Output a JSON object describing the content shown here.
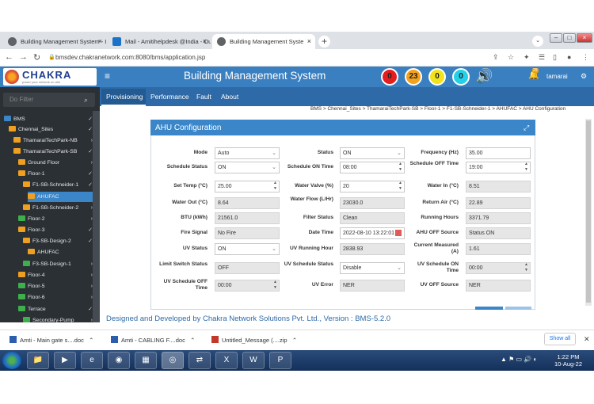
{
  "browser": {
    "tabs": [
      {
        "label": "Building Management System - I",
        "active": false
      },
      {
        "label": "Mail - Amitihelpdesk @India - Ou",
        "active": false
      },
      {
        "label": "Building Management Syste",
        "active": true
      }
    ],
    "url": "bmsdev.chakranetwork.com:8080/bms/application.jsp"
  },
  "header": {
    "logo_text": "CHAKRA",
    "logo_sub": "power your network on ahe",
    "title": "Building Management System",
    "alarm_counts": [
      {
        "value": "0",
        "color": "#e31e1e"
      },
      {
        "value": "23",
        "color": "#f5a21a"
      },
      {
        "value": "0",
        "color": "#f2e21b"
      },
      {
        "value": "0",
        "color": "#22d0e8"
      }
    ],
    "bell_count": "29",
    "user": "tamarai"
  },
  "sidebar": {
    "filter_placeholder": "Do Filter",
    "items": [
      {
        "label": "BMS",
        "indent": 0,
        "color": "#3a86c8",
        "chev": "✓"
      },
      {
        "label": "Chennai_Sites",
        "indent": 1,
        "color": "#f0a020",
        "chev": "✓"
      },
      {
        "label": "ThamaraiTechPark-NB",
        "indent": 2,
        "color": "#f0a020",
        "chev": "›"
      },
      {
        "label": "ThamaraiTechPark-SB",
        "indent": 2,
        "color": "#f0a020",
        "chev": "✓"
      },
      {
        "label": "Ground Floor",
        "indent": 3,
        "color": "#f0a020",
        "chev": "›"
      },
      {
        "label": "Floor-1",
        "indent": 3,
        "color": "#f0a020",
        "chev": "✓"
      },
      {
        "label": "F1-SB-Schneider-1",
        "indent": 4,
        "color": "#f0a020",
        "chev": "✓"
      },
      {
        "label": "AHUFAC",
        "indent": 5,
        "color": "#f0a020",
        "chev": "",
        "selected": true
      },
      {
        "label": "F1-SB-Schneider-2",
        "indent": 4,
        "color": "#f0a020",
        "chev": "›"
      },
      {
        "label": "Floor-2",
        "indent": 3,
        "color": "#3cb04a",
        "chev": "›"
      },
      {
        "label": "Floor-3",
        "indent": 3,
        "color": "#f0a020",
        "chev": "✓"
      },
      {
        "label": "F3-SB-Design-2",
        "indent": 4,
        "color": "#f0a020",
        "chev": "✓"
      },
      {
        "label": "AHUFAC",
        "indent": 5,
        "color": "#f0a020",
        "chev": ""
      },
      {
        "label": "F3-SB-Design-1",
        "indent": 4,
        "color": "#3cb04a",
        "chev": "›"
      },
      {
        "label": "Floor-4",
        "indent": 3,
        "color": "#f0a020",
        "chev": "›"
      },
      {
        "label": "Floor-5",
        "indent": 3,
        "color": "#3cb04a",
        "chev": "›"
      },
      {
        "label": "Floor-6",
        "indent": 3,
        "color": "#3cb04a",
        "chev": "›"
      },
      {
        "label": "Terrace",
        "indent": 3,
        "color": "#3cb04a",
        "chev": "✓"
      },
      {
        "label": "Secondary-Pump",
        "indent": 4,
        "color": "#3cb04a",
        "chev": "›"
      }
    ]
  },
  "menu": [
    "Provisioning",
    "Performance",
    "Fault",
    "About"
  ],
  "breadcrumb": "BMS  >  Chennai_Sites  >  ThamaraiTechPark-SB  >  Floor-1  >  F1-SB-Schneider-1  >  AHUFAC  >  AHU Configuration",
  "panel": {
    "title": "AHU Configuration",
    "fields": [
      {
        "label": "Mode",
        "value": "Auto",
        "type": "select"
      },
      {
        "label": "Status",
        "value": "ON",
        "type": "select"
      },
      {
        "label": "Frequency (Hz)",
        "value": "35.00",
        "type": "text"
      },
      {
        "label": "Schedule Status",
        "value": "ON",
        "type": "select"
      },
      {
        "label": "Schedule ON Time",
        "value": "08:00",
        "type": "spin"
      },
      {
        "label": "Schedule OFF Time",
        "value": "19:00",
        "type": "spin"
      },
      {
        "label": "Set Temp (°C)",
        "value": "25.00",
        "type": "spin"
      },
      {
        "label": "Water Valve (%)",
        "value": "20",
        "type": "spin"
      },
      {
        "label": "Water In (°C)",
        "value": "8.51",
        "type": "ro"
      },
      {
        "label": "Water Out (°C)",
        "value": "8.64",
        "type": "ro"
      },
      {
        "label": "Water Flow (L/Hr)",
        "value": "23030.0",
        "type": "ro"
      },
      {
        "label": "Return Air (°C)",
        "value": "22.89",
        "type": "ro"
      },
      {
        "label": "BTU (kWh)",
        "value": "21561.0",
        "type": "ro"
      },
      {
        "label": "Filter Status",
        "value": "Clean",
        "type": "ro"
      },
      {
        "label": "Running Hours",
        "value": "3371.79",
        "type": "ro"
      },
      {
        "label": "Fire Signal",
        "value": "No Fire",
        "type": "ro"
      },
      {
        "label": "Date Time",
        "value": "2022-08-10 13:22:01",
        "type": "date"
      },
      {
        "label": "AHU OFF Source",
        "value": "Status ON",
        "type": "ro"
      },
      {
        "label": "UV Status",
        "value": "ON",
        "type": "select"
      },
      {
        "label": "UV Running Hour",
        "value": "2838.93",
        "type": "ro"
      },
      {
        "label": "Current Measured (A)",
        "value": "1.61",
        "type": "ro"
      },
      {
        "label": "Limit Switch Status",
        "value": "OFF",
        "type": "ro"
      },
      {
        "label": "UV Schedule Status",
        "value": "Disable",
        "type": "select"
      },
      {
        "label": "UV Schedule ON Time",
        "value": "00:00",
        "type": "spinro"
      },
      {
        "label": "UV Schedule OFF Time",
        "value": "00:00",
        "type": "spinro"
      },
      {
        "label": "UV Error",
        "value": "NER",
        "type": "ro"
      },
      {
        "label": "UV OFF Source",
        "value": "NER",
        "type": "ro"
      }
    ]
  },
  "footer": "Designed and Developed by Chakra Network Solutions Pvt. Ltd.,  Version : BMS-5.2.0",
  "downloads": [
    "Amti - Main gate s....doc",
    "Amti - CABLING F....doc",
    "Untitled_Message (....zip"
  ],
  "show_all": "Show all",
  "clock": {
    "time": "1:22 PM",
    "date": "10-Aug-22"
  }
}
